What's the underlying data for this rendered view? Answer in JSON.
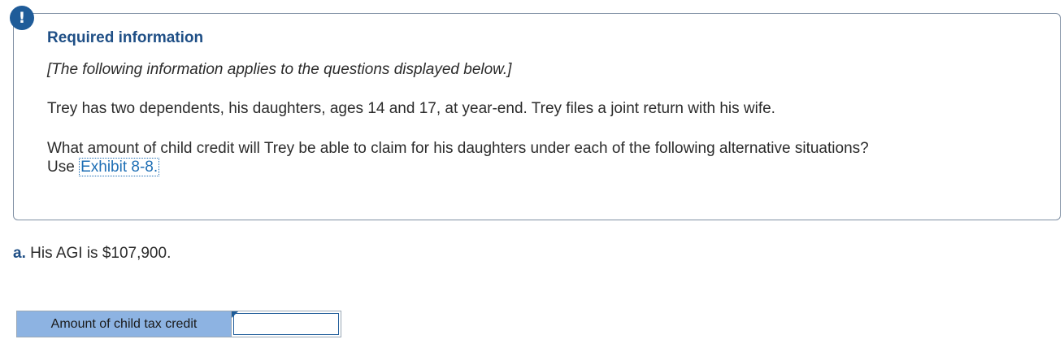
{
  "alert": {
    "symbol": "!"
  },
  "info": {
    "title": "Required information",
    "note": "[The following information applies to the questions displayed below.]",
    "paragraph1": "Trey has two dependents, his daughters, ages 14 and 17, at year-end. Trey files a joint return with his wife.",
    "paragraph2_text": "What amount of child credit will Trey be able to claim for his daughters under each of the following alternative situations?",
    "paragraph2_use": "Use",
    "exhibit_link": "Exhibit 8-8."
  },
  "question": {
    "letter": "a.",
    "text": "His AGI is $107,900."
  },
  "answer": {
    "label": "Amount of child tax credit",
    "value": ""
  },
  "colors": {
    "accent": "#1f5c99",
    "title": "#1f4f86",
    "label_bg": "#8db3e2",
    "link": "#1f6fb5"
  },
  "icons": {
    "alert": "exclamation-icon"
  }
}
